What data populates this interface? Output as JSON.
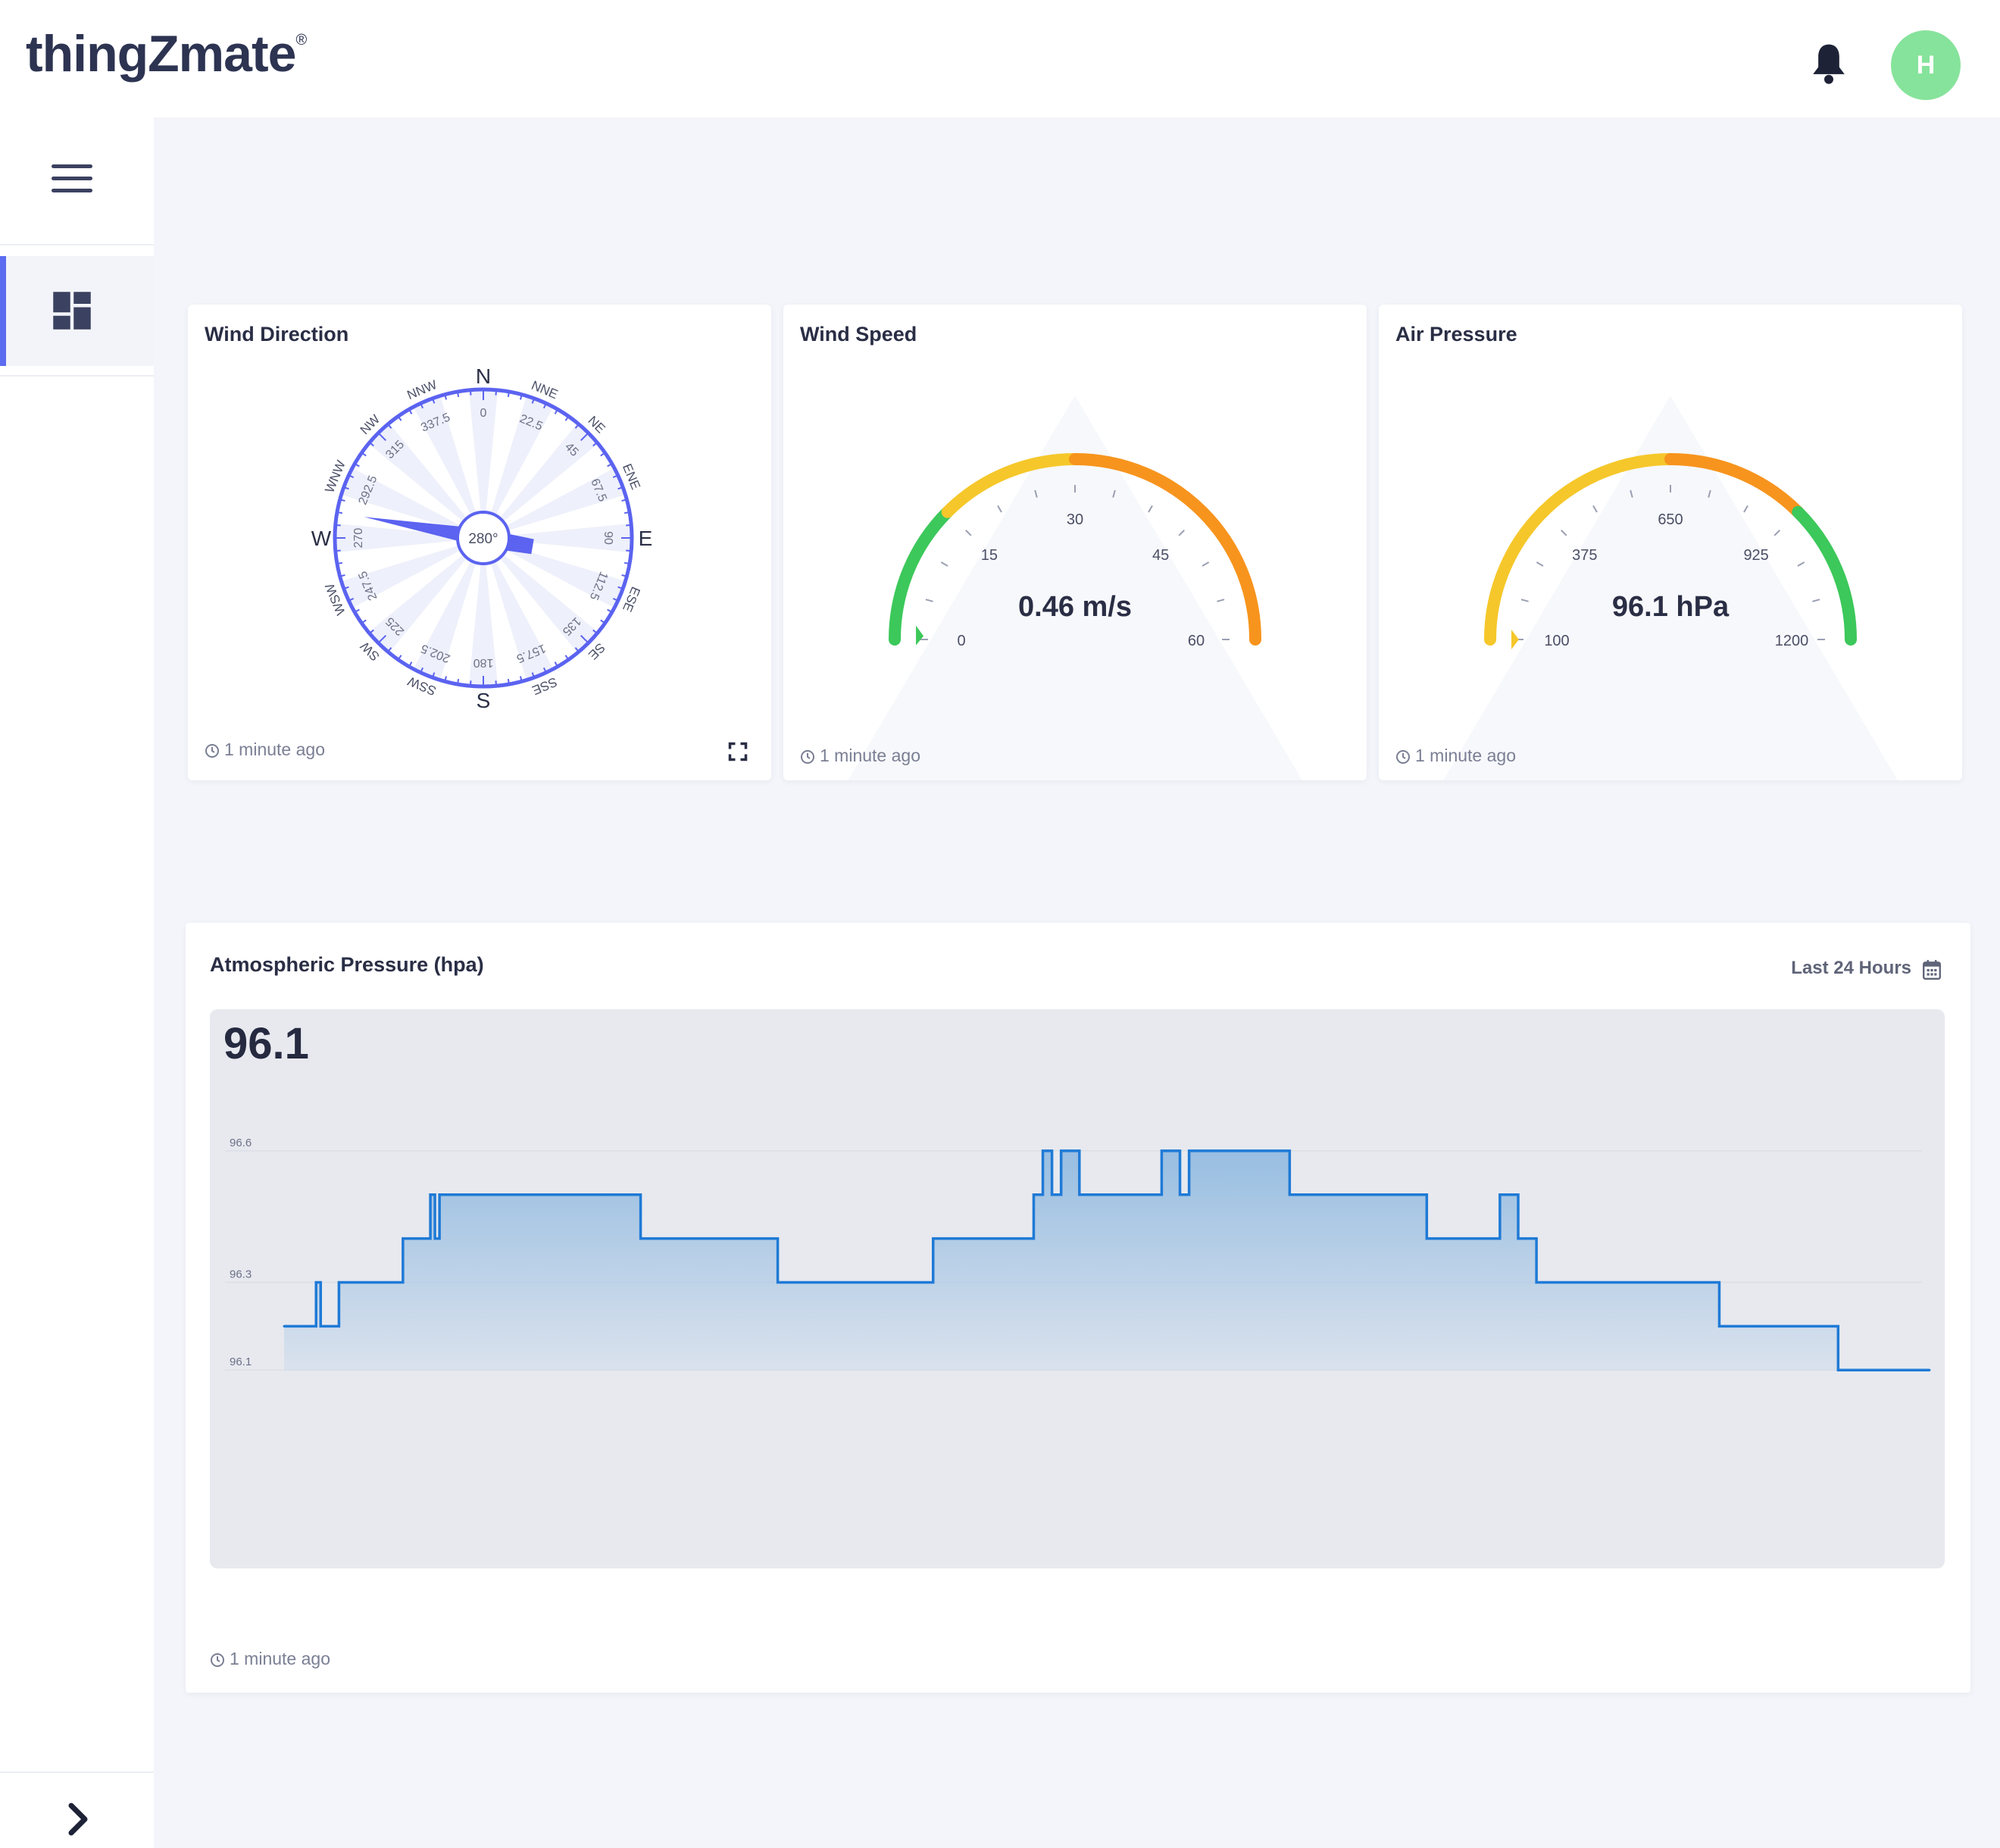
{
  "header": {
    "logo_text": "thingZmate",
    "logo_mark": "®",
    "notification_icon": "bell-icon",
    "avatar_initial": "H",
    "avatar_color": "#86e39b"
  },
  "sidebar": {
    "menu_icon": "hamburger-icon",
    "items": [
      {
        "icon": "dashboard-icon",
        "active": true
      }
    ],
    "collapse_icon": "chevron-right-icon",
    "accent_color": "#5b6cf0"
  },
  "widgets": {
    "wind_direction": {
      "title": "Wind Direction",
      "value_label": "280°",
      "bearing_degrees": 280,
      "cardinals": [
        "N",
        "E",
        "S",
        "W"
      ],
      "directions": [
        {
          "name": "N",
          "deg": "0"
        },
        {
          "name": "NNE",
          "deg": "22.5"
        },
        {
          "name": "NE",
          "deg": "45"
        },
        {
          "name": "ENE",
          "deg": "67.5"
        },
        {
          "name": "E",
          "deg": "90"
        },
        {
          "name": "ESE",
          "deg": "112.5"
        },
        {
          "name": "SE",
          "deg": "135"
        },
        {
          "name": "SSE",
          "deg": "157.5"
        },
        {
          "name": "S",
          "deg": "180"
        },
        {
          "name": "SSW",
          "deg": "202.5"
        },
        {
          "name": "SW",
          "deg": "225"
        },
        {
          "name": "WSW",
          "deg": "247.5"
        },
        {
          "name": "W",
          "deg": "270"
        },
        {
          "name": "WNW",
          "deg": "292.5"
        },
        {
          "name": "NW",
          "deg": "315"
        },
        {
          "name": "NNW",
          "deg": "337.5"
        }
      ],
      "updated": "1 minute ago",
      "expand_icon": "expand-icon"
    },
    "wind_speed": {
      "title": "Wind Speed",
      "value": "0.46 m/s",
      "reading": 0.46,
      "min": 0,
      "max": 60,
      "ticks": [
        "0",
        "15",
        "30",
        "45",
        "60"
      ],
      "colors": [
        "#3cc85a",
        "#f5c72a",
        "#f7941d",
        "#f7941d"
      ],
      "pointer_color": "#3cc85a",
      "updated": "1 minute ago"
    },
    "air_pressure": {
      "title": "Air Pressure",
      "value": "96.1 hPa",
      "reading": 96.1,
      "min": 100,
      "max": 1200,
      "ticks": [
        "100",
        "375",
        "650",
        "925",
        "1200"
      ],
      "colors": [
        "#f5c72a",
        "#f5c72a",
        "#f7941d",
        "#3cc85a"
      ],
      "pointer_color": "#f5c72a",
      "updated": "1 minute ago"
    }
  },
  "chart_card": {
    "title": "Atmospheric Pressure (hpa)",
    "range_label": "Last 24 Hours",
    "calendar_icon": "calendar-icon",
    "current_value": "96.1",
    "updated": "1 minute ago"
  },
  "chart_data": {
    "type": "area",
    "title": "Atmospheric Pressure (hpa)",
    "xlabel": "",
    "ylabel": "",
    "yticks": [
      "96.6",
      "96.3",
      "96.1"
    ],
    "ylim": [
      95.9,
      96.75
    ],
    "x": [
      0,
      3,
      3.5,
      4,
      6,
      13,
      16,
      16.5,
      17,
      35,
      39,
      54,
      58,
      71,
      82,
      83,
      84,
      85,
      87,
      96,
      98,
      99,
      100,
      110,
      125,
      133,
      135,
      137,
      141,
      157,
      161,
      170,
      175,
      180
    ],
    "values": [
      96.2,
      96.2,
      96.3,
      96.2,
      96.3,
      96.4,
      96.5,
      96.4,
      96.5,
      96.5,
      96.4,
      96.3,
      96.3,
      96.4,
      96.5,
      96.6,
      96.5,
      96.6,
      96.5,
      96.6,
      96.5,
      96.6,
      96.6,
      96.5,
      96.4,
      96.5,
      96.4,
      96.3,
      96.3,
      96.2,
      96.2,
      96.1,
      96.1,
      96.1
    ],
    "line_color": "#1f7ad6",
    "fill_color": "#8fb9e0",
    "grid": true
  }
}
